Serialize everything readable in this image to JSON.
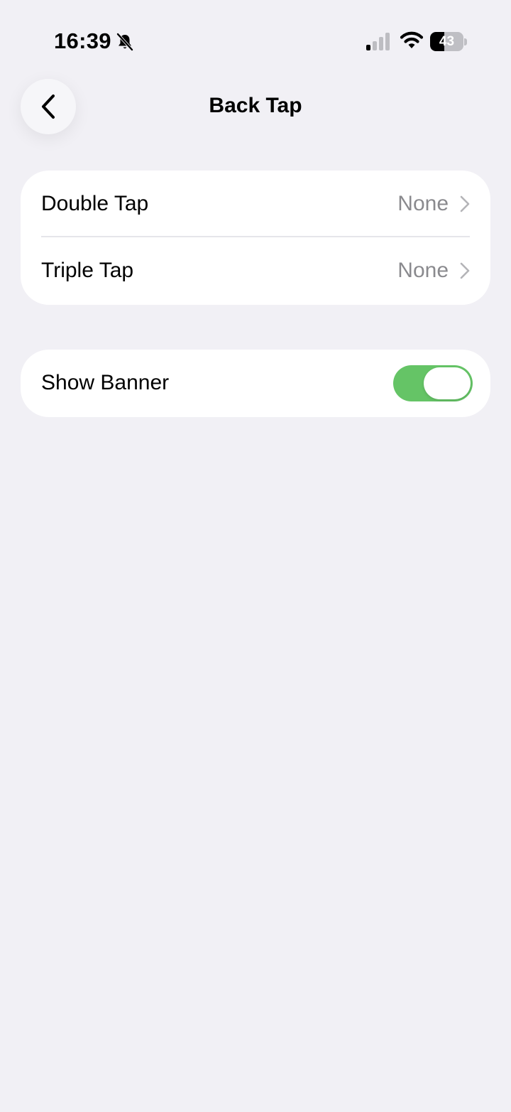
{
  "status_bar": {
    "time": "16:39",
    "battery": "43",
    "battery_level": 0.43,
    "silent_icon": "bell-slash-icon",
    "signal_icon": "cellular-signal-icon",
    "wifi_icon": "wifi-icon"
  },
  "nav": {
    "back_icon": "chevron-left-icon",
    "title": "Back Tap"
  },
  "tap_actions": {
    "rows": [
      {
        "label": "Double Tap",
        "value": "None"
      },
      {
        "label": "Triple Tap",
        "value": "None"
      }
    ]
  },
  "banner": {
    "label": "Show Banner",
    "enabled": true,
    "toggle_color": "#65c466"
  },
  "colors": {
    "background": "#f1f0f5",
    "card": "#ffffff",
    "secondary_text": "#8a8a8e"
  }
}
